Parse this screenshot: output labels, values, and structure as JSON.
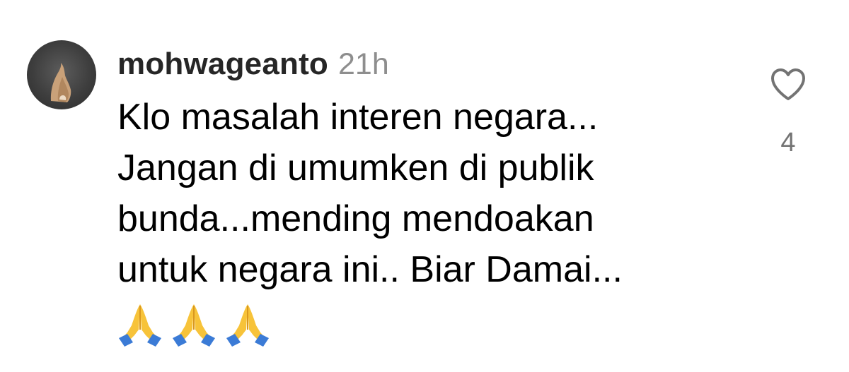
{
  "comment": {
    "username": "mohwageanto",
    "time": "21h",
    "text_lines": [
      "Klo masalah interen negara...",
      "Jangan di umumken di publik",
      "bunda...mending mendoakan",
      "untuk negara ini.. Biar Damai..."
    ],
    "emojis": [
      "folded-hands-icon",
      "folded-hands-icon",
      "folded-hands-icon"
    ],
    "like": {
      "icon": "heart-outline-icon",
      "count": "4"
    }
  },
  "colors": {
    "username": "#262626",
    "timestamp": "#8e8e8e",
    "text": "#000000",
    "like_count": "#737373"
  }
}
